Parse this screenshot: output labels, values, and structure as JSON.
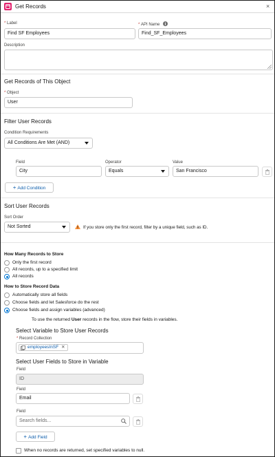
{
  "header": {
    "title": "Get Records",
    "close_glyph": "×"
  },
  "details": {
    "label_field": {
      "label": "Label",
      "value": "Find SF Employees"
    },
    "api_field": {
      "label": "API Name",
      "value": "Find_SF_Employees"
    },
    "description_label": "Description"
  },
  "object_section": {
    "title": "Get Records of This Object",
    "object_label": "Object",
    "object_value": "User"
  },
  "filter_section": {
    "title": "Filter User Records",
    "conditions_label": "Condition Requirements",
    "conditions_value": "All Conditions Are Met (AND)",
    "columns": {
      "field": "Field",
      "operator": "Operator",
      "value": "Value"
    },
    "row": {
      "field": "City",
      "operator": "Equals",
      "value": "San Francisco"
    },
    "add_condition_label": "Add Condition"
  },
  "sort_section": {
    "title": "Sort User Records",
    "order_label": "Sort Order",
    "order_value": "Not Sorted",
    "warning_text": "If you store only the first record, filter by a unique field, such as ID."
  },
  "store_count": {
    "title": "How Many Records to Store",
    "options": [
      "Only the first record",
      "All records, up to a specified limit",
      "All records"
    ],
    "selected_index": 2
  },
  "store_how": {
    "title": "How to Store Record Data",
    "options": [
      "Automatically store all fields",
      "Choose fields and let Salesforce do the rest",
      "Choose fields and assign variables (advanced)"
    ],
    "selected_index": 2,
    "hint_prefix": "To use the returned ",
    "hint_bold": "User",
    "hint_suffix": " records in the flow, store their fields in variables."
  },
  "variable_section": {
    "title": "Select Variable to Store User Records",
    "collection_label": "Record Collection",
    "collection_value": "employeesInSF",
    "remove_glyph": "✕"
  },
  "fields_section": {
    "title": "Select User Fields to Store in Variable",
    "field_label": "Field",
    "fields": [
      "ID",
      "Email"
    ],
    "search_placeholder": "Search fields...",
    "add_field_label": "Add Field",
    "null_checkbox_label": "When no records are returned, set specified variables to null."
  },
  "colors": {
    "accent": "#0176d3",
    "brand_icon": "#e3216d",
    "required": "#c23934",
    "warning": "#fe9339"
  }
}
